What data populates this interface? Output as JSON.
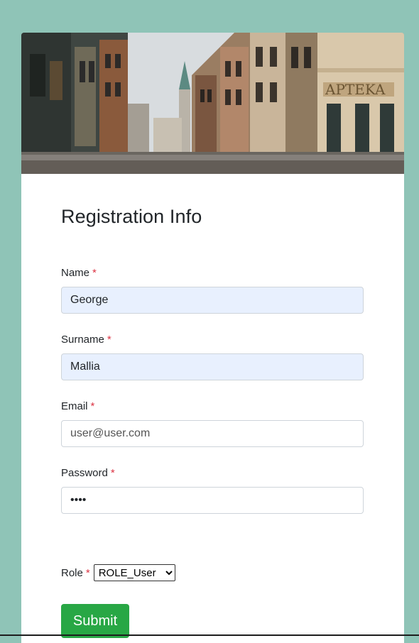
{
  "form": {
    "title": "Registration Info",
    "required_marker": "*",
    "name": {
      "label": "Name",
      "value": "George"
    },
    "surname": {
      "label": "Surname",
      "value": "Mallia"
    },
    "email": {
      "label": "Email",
      "placeholder": "user@user.com",
      "value": ""
    },
    "password": {
      "label": "Password",
      "value": "abcd"
    },
    "role": {
      "label": "Role",
      "selected": "ROLE_User"
    },
    "submit_label": "Submit"
  },
  "colors": {
    "background": "#8fc4b7",
    "submit": "#28a745",
    "required": "#dc3545",
    "autofill": "#e8f0fe"
  }
}
